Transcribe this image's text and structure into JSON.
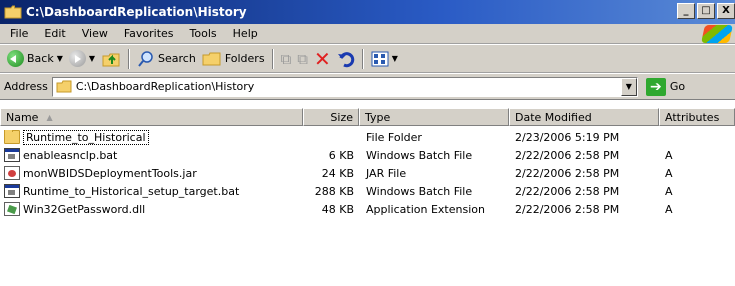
{
  "window": {
    "title": "C:\\DashboardReplication\\History",
    "minimize": "_",
    "maximize": "□",
    "close": "X"
  },
  "menu": {
    "items": [
      {
        "label": "File"
      },
      {
        "label": "Edit"
      },
      {
        "label": "View"
      },
      {
        "label": "Favorites"
      },
      {
        "label": "Tools"
      },
      {
        "label": "Help"
      }
    ]
  },
  "toolbar": {
    "back_label": "Back",
    "search_label": "Search",
    "folders_label": "Folders"
  },
  "address": {
    "label": "Address",
    "value": "C:\\DashboardReplication\\History",
    "go_label": "Go"
  },
  "columns": [
    {
      "label": "Name"
    },
    {
      "label": "Size"
    },
    {
      "label": "Type"
    },
    {
      "label": "Date Modified"
    },
    {
      "label": "Attributes"
    }
  ],
  "files": [
    {
      "name": "Runtime_to_Historical",
      "size": "",
      "type": "File Folder",
      "date": "2/23/2006 5:19 PM",
      "attr": "",
      "icon": "folder-icon"
    },
    {
      "name": "enableasnclp.bat",
      "size": "6 KB",
      "type": "Windows Batch File",
      "date": "2/22/2006 2:58 PM",
      "attr": "A",
      "icon": "batch-file-icon"
    },
    {
      "name": "monWBIDSDeploymentTools.jar",
      "size": "24 KB",
      "type": "JAR File",
      "date": "2/22/2006 2:58 PM",
      "attr": "A",
      "icon": "jar-file-icon"
    },
    {
      "name": "Runtime_to_Historical_setup_target.bat",
      "size": "288 KB",
      "type": "Windows Batch File",
      "date": "2/22/2006 2:58 PM",
      "attr": "A",
      "icon": "batch-file-icon"
    },
    {
      "name": "Win32GetPassword.dll",
      "size": "48 KB",
      "type": "Application Extension",
      "date": "2/22/2006 2:58 PM",
      "attr": "A",
      "icon": "dll-file-icon"
    }
  ]
}
